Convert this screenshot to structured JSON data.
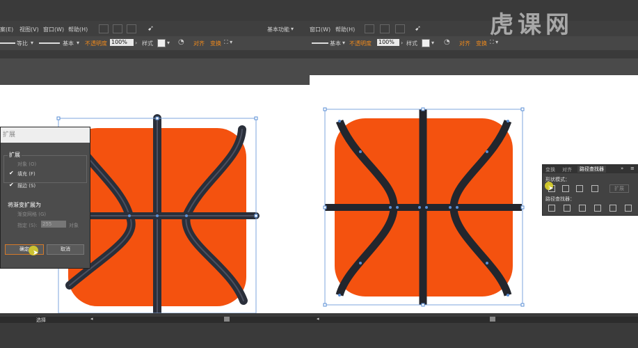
{
  "left_app": {
    "menu": [
      "案(E)",
      "视图(V)",
      "窗口(W)",
      "帮助(H)"
    ],
    "toolbar": {
      "stroke_style_left": "等比",
      "stroke_style_right": "基本",
      "opacity_label": "不透明度",
      "opacity_value": "100%",
      "style_label": "样式",
      "align_label": "对齐",
      "transform_label": "变换"
    },
    "expand_dialog": {
      "title": "扩展",
      "section_expand": "扩展",
      "object_option": "对象 (O)",
      "fill_option": "填充 (F)",
      "stroke_option": "描边 (S)",
      "section_gradient": "将渐变扩展为",
      "gradient_mesh": "渐变网格 (G)",
      "specify_label": "指定 (S):",
      "specify_value": "255",
      "specify_unit": "对象",
      "ok_button": "确定",
      "cancel_button": "取消"
    },
    "status_text": "选择"
  },
  "right_app": {
    "workspace_label": "基本功能",
    "menu": [
      "窗口(W)",
      "帮助(H)"
    ],
    "toolbar": {
      "stroke_style": "基本",
      "opacity_label": "不透明度",
      "opacity_value": "100%",
      "style_label": "样式",
      "align_label": "对齐",
      "transform_label": "变换"
    },
    "pathfinder_panel": {
      "tabs": [
        "变换",
        "对齐",
        "路径查找器"
      ],
      "shape_modes_label": "形状模式：",
      "expand_button": "扩展",
      "pathfinders_label": "路径查找器："
    }
  },
  "watermark": "虎课网",
  "colors": {
    "ball_orange": "#f4520f",
    "seam_dark": "#23262d",
    "selection_blue": "#5a8fd6",
    "accent_orange_text": "#f08a1c"
  }
}
